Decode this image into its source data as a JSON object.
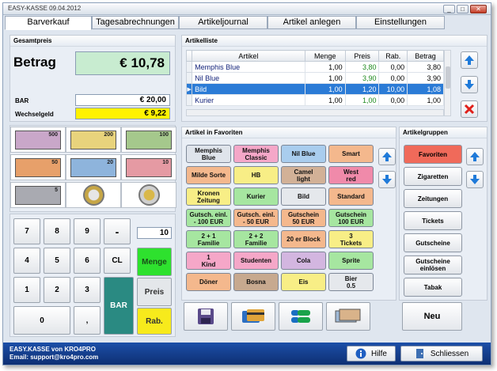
{
  "window": {
    "title": "EASY-KASSE 09.04.2012",
    "controls": [
      "_",
      "□",
      "✕"
    ]
  },
  "tabs": [
    "Barverkauf",
    "Tagesabrechnungen",
    "Artikeljournal",
    "Artikel anlegen",
    "Einstellungen"
  ],
  "summary": {
    "header": "Gesamtpreis",
    "betrag_label": "Betrag",
    "betrag_value": "€ 10,78",
    "bar_label": "BAR",
    "bar_value": "€ 20,00",
    "wechsel_label": "Wechselgeld",
    "wechsel_value": "€ 9,22"
  },
  "articles": {
    "header": "Artikelliste",
    "columns": [
      "Artikel",
      "Menge",
      "Preis",
      "Rab.",
      "Betrag"
    ],
    "rows": [
      {
        "name": "Memphis Blue",
        "menge": "1,00",
        "preis": "3,80",
        "rab": "0,00",
        "betrag": "3,80"
      },
      {
        "name": "Nil Blue",
        "menge": "1,00",
        "preis": "3,90",
        "rab": "0,00",
        "betrag": "3,90"
      },
      {
        "name": "Bild",
        "menge": "1,00",
        "preis": "1,20",
        "rab": "10,00",
        "betrag": "1,08"
      },
      {
        "name": "Kurier",
        "menge": "1,00",
        "preis": "1,00",
        "rab": "0,00",
        "betrag": "1,00"
      }
    ],
    "selected_indicator": "▶"
  },
  "money": [
    {
      "label": "500",
      "color": "#c9a7c9"
    },
    {
      "label": "200",
      "color": "#e8d37c"
    },
    {
      "label": "100",
      "color": "#a5c88c"
    },
    {
      "label": "50",
      "color": "#e7a06a"
    },
    {
      "label": "20",
      "color": "#8eb4dc"
    },
    {
      "label": "10",
      "color": "#e59aa3"
    },
    {
      "label": "5",
      "color": "#a9aab1"
    }
  ],
  "keypad": {
    "keys": [
      "7",
      "8",
      "9",
      "-",
      "4",
      "5",
      "6",
      "CL",
      "1",
      "2",
      "3",
      "0",
      ","
    ],
    "bar": "BAR",
    "display": "10",
    "menge": "Menge",
    "preis": "Preis",
    "rab": "Rab."
  },
  "favorites": {
    "header": "Artikel in Favoriten",
    "buttons": [
      {
        "label": "Memphis\nBlue",
        "color": "#dfe4eb"
      },
      {
        "label": "Memphis\nClassic",
        "color": "#f5a7c8"
      },
      {
        "label": "Nil Blue",
        "color": "#a9cdee"
      },
      {
        "label": "Smart",
        "color": "#f4b88d"
      },
      {
        "label": "Milde Sorte",
        "color": "#f4b88d"
      },
      {
        "label": "HB",
        "color": "#f8ee86"
      },
      {
        "label": "Camel\nlight",
        "color": "#d2b197"
      },
      {
        "label": "West\nred",
        "color": "#f08aaa"
      },
      {
        "label": "Kronen\nZeitung",
        "color": "#f8ee86"
      },
      {
        "label": "Kurier",
        "color": "#a6e6a0"
      },
      {
        "label": "Bild",
        "color": "#e5e8ec"
      },
      {
        "label": "Standard",
        "color": "#f4b88d"
      },
      {
        "label": "Gutsch. einl.\n- 100 EUR",
        "color": "#a6e6a0"
      },
      {
        "label": "Gutsch. einl.\n- 50 EUR",
        "color": "#f4b88d"
      },
      {
        "label": "Gutschein\n50 EUR",
        "color": "#f4b88d"
      },
      {
        "label": "Gutschein\n100 EUR",
        "color": "#a6e6a0"
      },
      {
        "label": "2 + 1\nFamilie",
        "color": "#a6e6a0"
      },
      {
        "label": "2 + 2\nFamilie",
        "color": "#a6e6a0"
      },
      {
        "label": "20 er Block",
        "color": "#f4b88d"
      },
      {
        "label": "3\nTickets",
        "color": "#f8ee86"
      },
      {
        "label": "1\nKind",
        "color": "#f5a7c8"
      },
      {
        "label": "Studenten",
        "color": "#f5a7c8"
      },
      {
        "label": "Cola",
        "color": "#d3b6e0"
      },
      {
        "label": "Sprite",
        "color": "#a6e6a0"
      },
      {
        "label": "Döner",
        "color": "#f4b88d"
      },
      {
        "label": "Bosna",
        "color": "#c7a98f"
      },
      {
        "label": "Eis",
        "color": "#f8ee86"
      },
      {
        "label": "Bier\n0.5",
        "color": "#e5e8ec"
      }
    ]
  },
  "groups": {
    "header": "Artikelgruppen",
    "buttons": [
      "Favoriten",
      "Zigaretten",
      "Zeitungen",
      "Tickets",
      "Gutscheine",
      "Gutscheine\neinlösen",
      "Tabak"
    ],
    "active_color": "#f06a5a"
  },
  "actions": {
    "neu": "Neu"
  },
  "status": {
    "line1": "EASY.KASSE von KRO4PRO",
    "line2": "Email: support@kro4pro.com",
    "hilfe": "Hilfe",
    "schliessen": "Schliessen"
  }
}
